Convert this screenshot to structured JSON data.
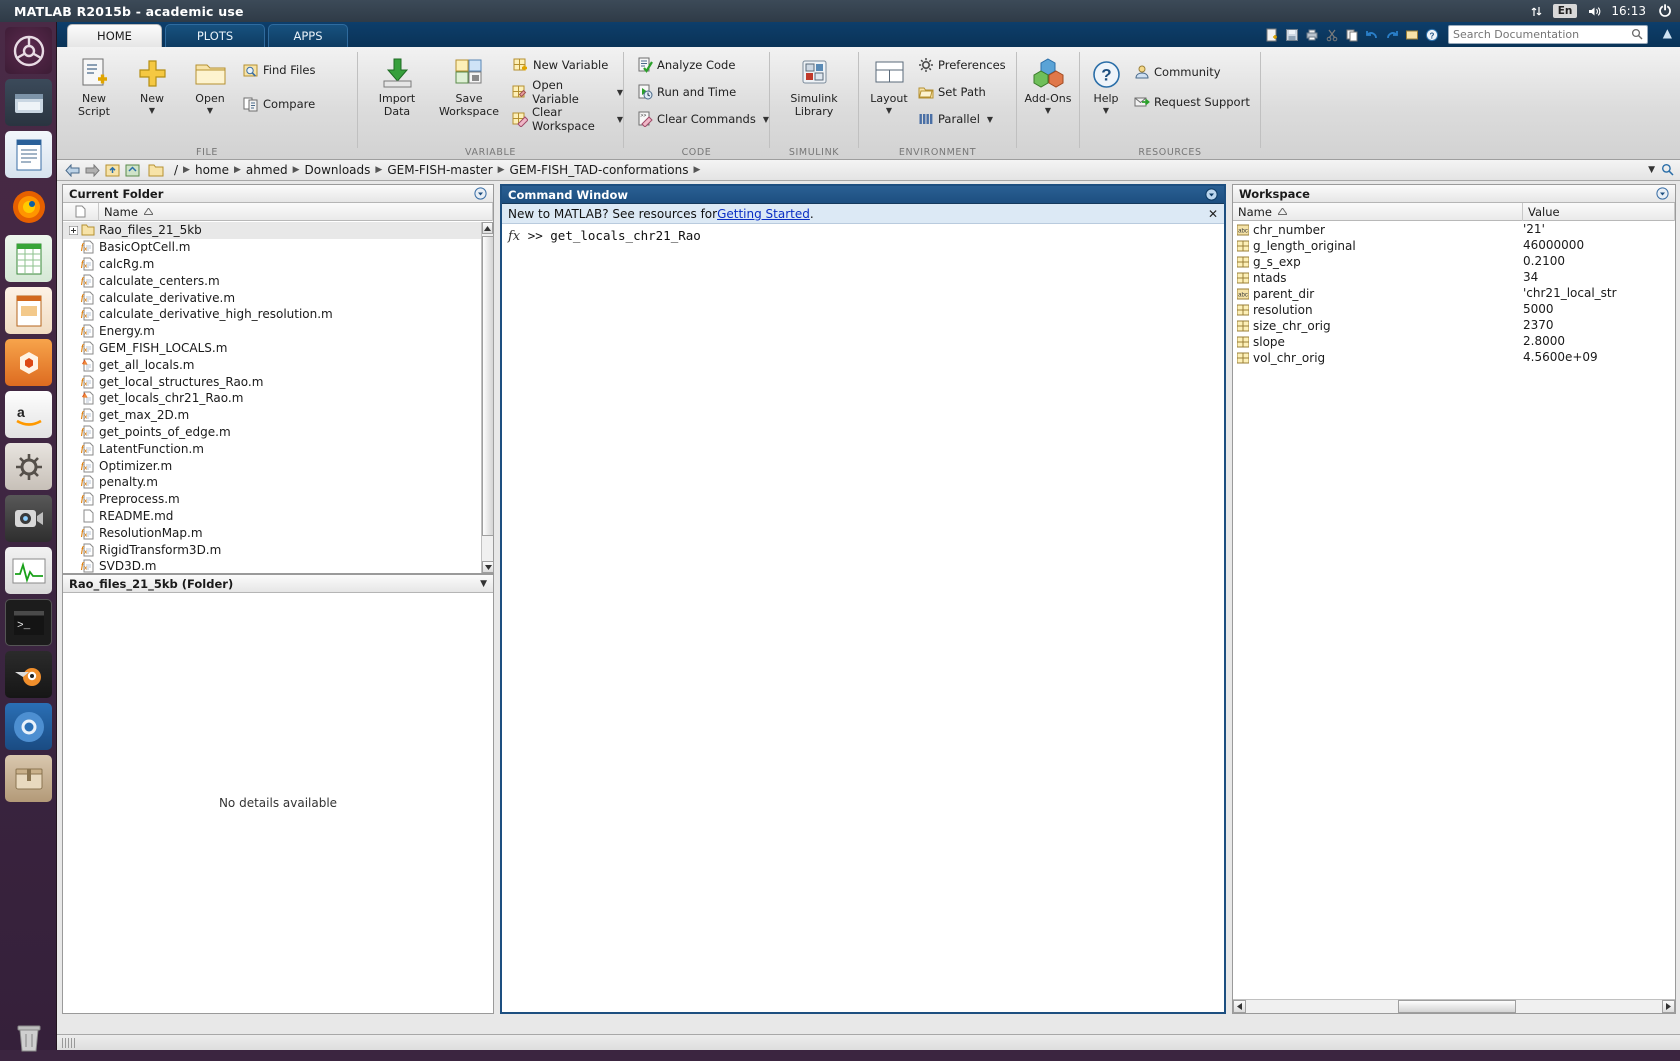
{
  "system": {
    "window_title": "MATLAB R2015b - academic use",
    "tray": {
      "network_icon": "network-updown-icon",
      "language": "En",
      "volume_icon": "volume-icon",
      "clock": "16:13",
      "close_icon": "close-icon"
    }
  },
  "launcher": {
    "items": [
      {
        "name": "ubuntu-dash-icon"
      },
      {
        "name": "files-manager-icon"
      },
      {
        "name": "libreoffice-writer-icon"
      },
      {
        "name": "firefox-icon"
      },
      {
        "name": "libreoffice-calc-icon"
      },
      {
        "name": "libreoffice-impress-icon"
      },
      {
        "name": "ubuntu-software-icon"
      },
      {
        "name": "amazon-icon"
      },
      {
        "name": "system-settings-icon"
      },
      {
        "name": "webcam-icon"
      },
      {
        "name": "system-monitor-icon"
      },
      {
        "name": "terminal-icon"
      },
      {
        "name": "blender-icon"
      },
      {
        "name": "chromium-icon"
      },
      {
        "name": "archive-manager-icon"
      },
      {
        "name": "trash-icon"
      }
    ]
  },
  "ribbon": {
    "tabs": [
      {
        "label": "HOME",
        "active": true
      },
      {
        "label": "PLOTS",
        "active": false
      },
      {
        "label": "APPS",
        "active": false
      }
    ],
    "search": {
      "placeholder": "Search Documentation"
    },
    "sections": [
      {
        "label": "FILE"
      },
      {
        "label": "VARIABLE"
      },
      {
        "label": "CODE"
      },
      {
        "label": "SIMULINK"
      },
      {
        "label": "ENVIRONMENT"
      },
      {
        "label": "RESOURCES"
      }
    ],
    "file": {
      "new_script": {
        "line1": "New",
        "line2": "Script",
        "icon": "new-script-icon"
      },
      "new": {
        "line1": "New",
        "line2": "",
        "icon": "new-plus-icon",
        "caret": true
      },
      "open": {
        "line1": "Open",
        "line2": "",
        "icon": "open-folder-icon",
        "caret": true
      },
      "find_files": {
        "label": "Find Files",
        "icon": "find-files-icon"
      },
      "compare": {
        "label": "Compare",
        "icon": "compare-icon"
      }
    },
    "variable": {
      "import_data": {
        "line1": "Import",
        "line2": "Data",
        "icon": "import-data-icon"
      },
      "save_workspace": {
        "line1": "Save",
        "line2": "Workspace",
        "icon": "save-workspace-icon"
      },
      "new_variable": {
        "label": "New Variable",
        "icon": "new-variable-icon"
      },
      "open_variable": {
        "label": "Open Variable",
        "icon": "open-variable-icon",
        "caret": true
      },
      "clear_workspace": {
        "label": "Clear Workspace",
        "icon": "clear-workspace-icon",
        "caret": true
      }
    },
    "code": {
      "analyze_code": {
        "label": "Analyze Code",
        "icon": "analyze-code-icon"
      },
      "run_and_time": {
        "label": "Run and Time",
        "icon": "run-and-time-icon"
      },
      "clear_commands": {
        "label": "Clear Commands",
        "icon": "clear-commands-icon",
        "caret": true
      }
    },
    "simulink": {
      "simulink_library": {
        "line1": "Simulink",
        "line2": "Library",
        "icon": "simulink-library-icon"
      }
    },
    "environment": {
      "layout": {
        "line1": "Layout",
        "line2": "",
        "icon": "layout-icon",
        "caret": true
      },
      "preferences": {
        "label": "Preferences",
        "icon": "preferences-gear-icon"
      },
      "set_path": {
        "label": "Set Path",
        "icon": "set-path-icon"
      },
      "parallel": {
        "label": "Parallel",
        "icon": "parallel-icon",
        "caret": true
      }
    },
    "resources": {
      "add_ons": {
        "line1": "Add-Ons",
        "line2": "",
        "icon": "add-ons-icon",
        "caret": true
      },
      "help": {
        "line1": "Help",
        "line2": "",
        "icon": "help-question-icon",
        "caret": true
      },
      "community": {
        "label": "Community",
        "icon": "community-icon"
      },
      "request_support": {
        "label": "Request Support",
        "icon": "request-support-icon"
      }
    }
  },
  "breadcrumb": {
    "back_icon": "back-arrow-icon",
    "forward_icon": "forward-arrow-icon",
    "up_icon": "up-folder-icon",
    "browse_icon": "browse-folder-icon",
    "folder_icon": "folder-icon",
    "root": "/",
    "segments": [
      "home",
      "ahmed",
      "Downloads",
      "GEM-FISH-master",
      "GEM-FISH_TAD-conformations"
    ],
    "dropdown_icon": "chevron-down-icon",
    "search_icon": "search-icon"
  },
  "current_folder": {
    "title": "Current Folder",
    "panel_menu_icon": "panel-options-icon",
    "columns": [
      "Name"
    ],
    "sort_icon": "sort-asc-icon",
    "file_col_icon": "file-column-icon",
    "items": [
      {
        "name": "Rao_files_21_5kb",
        "icon": "folder-icon",
        "expandable": true,
        "selected": true
      },
      {
        "name": "BasicOptCell.m",
        "icon": "m-function-icon"
      },
      {
        "name": "calcRg.m",
        "icon": "m-function-icon"
      },
      {
        "name": "calculate_centers.m",
        "icon": "m-function-icon"
      },
      {
        "name": "calculate_derivative.m",
        "icon": "m-function-icon"
      },
      {
        "name": "calculate_derivative_high_resolution.m",
        "icon": "m-function-icon"
      },
      {
        "name": "Energy.m",
        "icon": "m-function-icon"
      },
      {
        "name": "GEM_FISH_LOCALS.m",
        "icon": "m-function-icon"
      },
      {
        "name": "get_all_locals.m",
        "icon": "m-script-icon"
      },
      {
        "name": "get_local_structures_Rao.m",
        "icon": "m-function-icon"
      },
      {
        "name": "get_locals_chr21_Rao.m",
        "icon": "m-script-icon"
      },
      {
        "name": "get_max_2D.m",
        "icon": "m-function-icon"
      },
      {
        "name": "get_points_of_edge.m",
        "icon": "m-function-icon"
      },
      {
        "name": "LatentFunction.m",
        "icon": "m-function-icon"
      },
      {
        "name": "Optimizer.m",
        "icon": "m-function-icon"
      },
      {
        "name": "penalty.m",
        "icon": "m-function-icon"
      },
      {
        "name": "Preprocess.m",
        "icon": "m-function-icon"
      },
      {
        "name": "README.md",
        "icon": "text-file-icon"
      },
      {
        "name": "ResolutionMap.m",
        "icon": "m-function-icon"
      },
      {
        "name": "RigidTransform3D.m",
        "icon": "m-function-icon"
      },
      {
        "name": "SVD3D.m",
        "icon": "m-function-icon"
      }
    ],
    "scroll_up_icon": "scroll-up-icon",
    "scroll_down_icon": "scroll-down-icon"
  },
  "detail_pane": {
    "title": "Rao_files_21_5kb  (Folder)",
    "collapse_icon": "chevron-down-icon",
    "body_text": "No details available"
  },
  "command_window": {
    "title": "Command Window",
    "panel_menu_icon": "panel-options-icon",
    "banner": {
      "prefix": "New to MATLAB? See resources for ",
      "link": "Getting Started",
      "suffix": ".",
      "close_icon": "close-icon"
    },
    "fx_symbol": "fx",
    "prompt": ">>",
    "command": "get_locals_chr21_Rao"
  },
  "workspace": {
    "title": "Workspace",
    "panel_menu_icon": "panel-options-icon",
    "columns": [
      "Name",
      "Value"
    ],
    "sort_icon": "sort-asc-icon",
    "rows": [
      {
        "icon": "char-var-icon",
        "name": "chr_number",
        "value": "'21'"
      },
      {
        "icon": "matrix-var-icon",
        "name": "g_length_original",
        "value": "46000000"
      },
      {
        "icon": "matrix-var-icon",
        "name": "g_s_exp",
        "value": "0.2100"
      },
      {
        "icon": "matrix-var-icon",
        "name": "ntads",
        "value": "34"
      },
      {
        "icon": "char-var-icon",
        "name": "parent_dir",
        "value": "'chr21_local_str"
      },
      {
        "icon": "matrix-var-icon",
        "name": "resolution",
        "value": "5000"
      },
      {
        "icon": "matrix-var-icon",
        "name": "size_chr_orig",
        "value": "2370"
      },
      {
        "icon": "matrix-var-icon",
        "name": "slope",
        "value": "2.8000"
      },
      {
        "icon": "matrix-var-icon",
        "name": "vol_chr_orig",
        "value": "4.5600e+09"
      }
    ],
    "scroll_left_icon": "scroll-left-icon",
    "scroll_right_icon": "scroll-right-icon"
  },
  "status_bar": {
    "grip_icon": "resize-grip-icon"
  },
  "colors": {
    "matlab_blue": "#1d4f80",
    "ribbon_grey": "#dcdcdc",
    "banner_blue": "#dce9f5",
    "link_blue": "#0a2ec4",
    "launcher_purple": "#3b2540",
    "selection_grey": "#e8e8e8"
  }
}
